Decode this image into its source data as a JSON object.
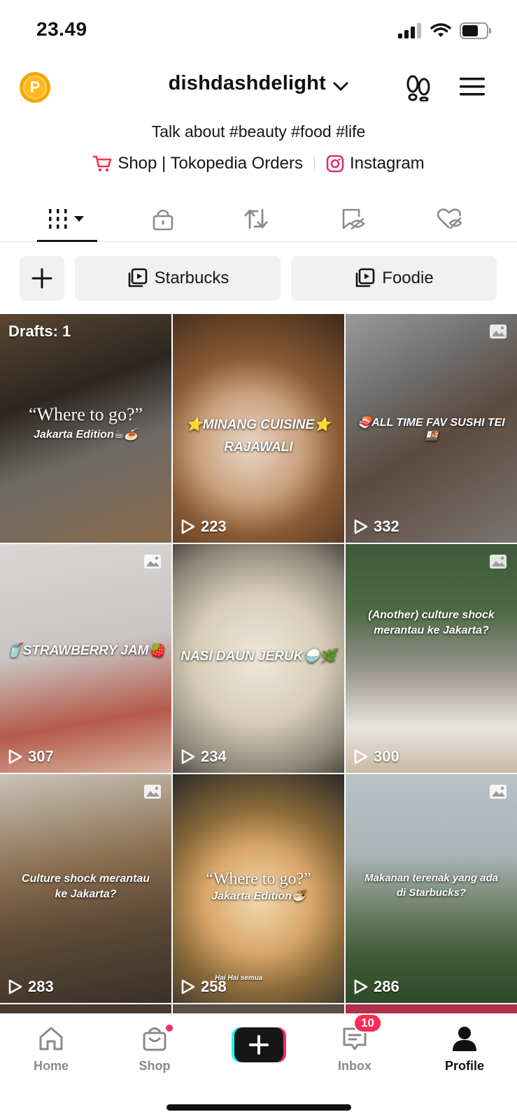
{
  "status_bar": {
    "time": "23.49"
  },
  "header": {
    "points_badge": "P",
    "username": "dishdashdelight"
  },
  "profile": {
    "bio": "Talk about #beauty #food #life",
    "links": [
      {
        "label": "Shop | Tokopedia Orders",
        "icon": "cart-icon"
      },
      {
        "label": "Instagram",
        "icon": "instagram-icon"
      }
    ]
  },
  "tabs": [
    "videos",
    "private",
    "reposts",
    "favorites",
    "liked"
  ],
  "playlists": [
    {
      "label": "Starbucks"
    },
    {
      "label": "Foodie"
    }
  ],
  "grid": {
    "drafts_label": "Drafts: 1",
    "tiles": [
      {
        "caption_line1": "“Where to go?”",
        "caption_line2": "Jakarta Edition☕🍝",
        "views": "",
        "photo": false
      },
      {
        "caption_line1": "⭐MINANG CUISINE⭐",
        "caption_line2": "RAJAWALI",
        "views": "223",
        "photo": false
      },
      {
        "caption_line1": "🍣ALL TIME FAV SUSHI TEI🍱",
        "caption_line2": "",
        "views": "332",
        "photo": true
      },
      {
        "caption_line1": "🥤STRAWBERRY JAM🍓",
        "caption_line2": "",
        "views": "307",
        "photo": true
      },
      {
        "caption_line1": "NASI DAUN JERUK🍚🌿",
        "caption_line2": "",
        "views": "234",
        "photo": false
      },
      {
        "caption_line1": "(Another) culture shock",
        "caption_line2": "merantau ke Jakarta?",
        "views": "300",
        "photo": true
      },
      {
        "caption_line1": "Culture shock merantau",
        "caption_line2": "ke Jakarta?",
        "views": "283",
        "photo": true
      },
      {
        "caption_line1": "“Where to go?”",
        "caption_line2": "Jakarta Edition🍜",
        "caption_line3": "Hai Hai semua",
        "views": "258",
        "photo": false
      },
      {
        "caption_line1": "Makanan terenak yang ada",
        "caption_line2": "di Starbucks?",
        "views": "286",
        "photo": true
      }
    ]
  },
  "bottom_nav": {
    "home": "Home",
    "shop": "Shop",
    "inbox": "Inbox",
    "inbox_badge": "10",
    "profile": "Profile"
  },
  "colors": {
    "accent": "#fe2c55",
    "cyan": "#25f4ee",
    "points": "#f7a600"
  }
}
